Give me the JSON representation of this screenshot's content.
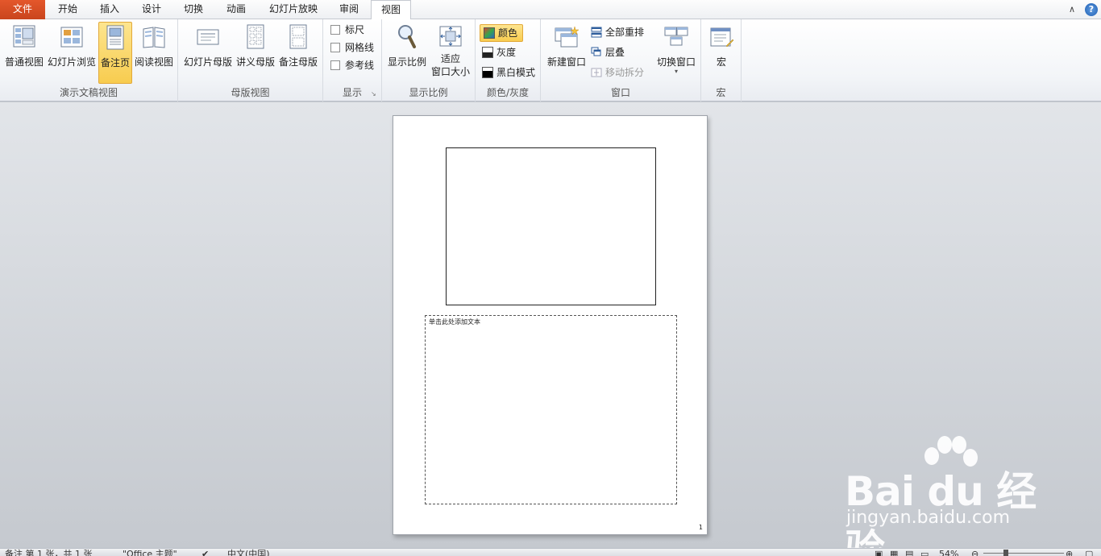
{
  "tabs": [
    {
      "label": "文件"
    },
    {
      "label": "开始"
    },
    {
      "label": "插入"
    },
    {
      "label": "设计"
    },
    {
      "label": "切换"
    },
    {
      "label": "动画"
    },
    {
      "label": "幻灯片放映"
    },
    {
      "label": "审阅"
    },
    {
      "label": "视图"
    }
  ],
  "active_tab": "视图",
  "ribbon": {
    "presentation_views": {
      "label": "演示文稿视图",
      "normal": "普通视图",
      "slide_sorter": "幻灯片浏览",
      "notes_page": "备注页",
      "reading_view": "阅读视图"
    },
    "master_views": {
      "label": "母版视图",
      "slide_master": "幻灯片母版",
      "handout_master": "讲义母版",
      "notes_master": "备注母版"
    },
    "show": {
      "label": "显示",
      "ruler": "标尺",
      "gridlines": "网格线",
      "guides": "参考线"
    },
    "zoom": {
      "label": "显示比例",
      "zoom": "显示比例",
      "fit_line1": "适应",
      "fit_line2": "窗口大小"
    },
    "color": {
      "label": "颜色/灰度",
      "color": "颜色",
      "grayscale": "灰度",
      "black_white": "黑白模式"
    },
    "window": {
      "label": "窗口",
      "new_window": "新建窗口",
      "arrange_all": "全部重排",
      "cascade": "层叠",
      "move_split": "移动拆分",
      "switch_windows": "切换窗口"
    },
    "macros": {
      "label": "宏",
      "macros": "宏"
    }
  },
  "page": {
    "notes_placeholder": "单击此处添加文本",
    "page_number": "1"
  },
  "watermark": {
    "main": "Bai du 经验",
    "sub": "jingyan.baidu.com"
  },
  "statusbar": {
    "view_info": "备注 第 1 张，共 1 张",
    "theme": "\"Office 主题\"",
    "language": "中文(中国)",
    "zoom": "54%"
  },
  "colors": {
    "file_tab": "#d44f23",
    "selected_button": "#f8cc4f",
    "workspace": "#c8ccd2"
  }
}
